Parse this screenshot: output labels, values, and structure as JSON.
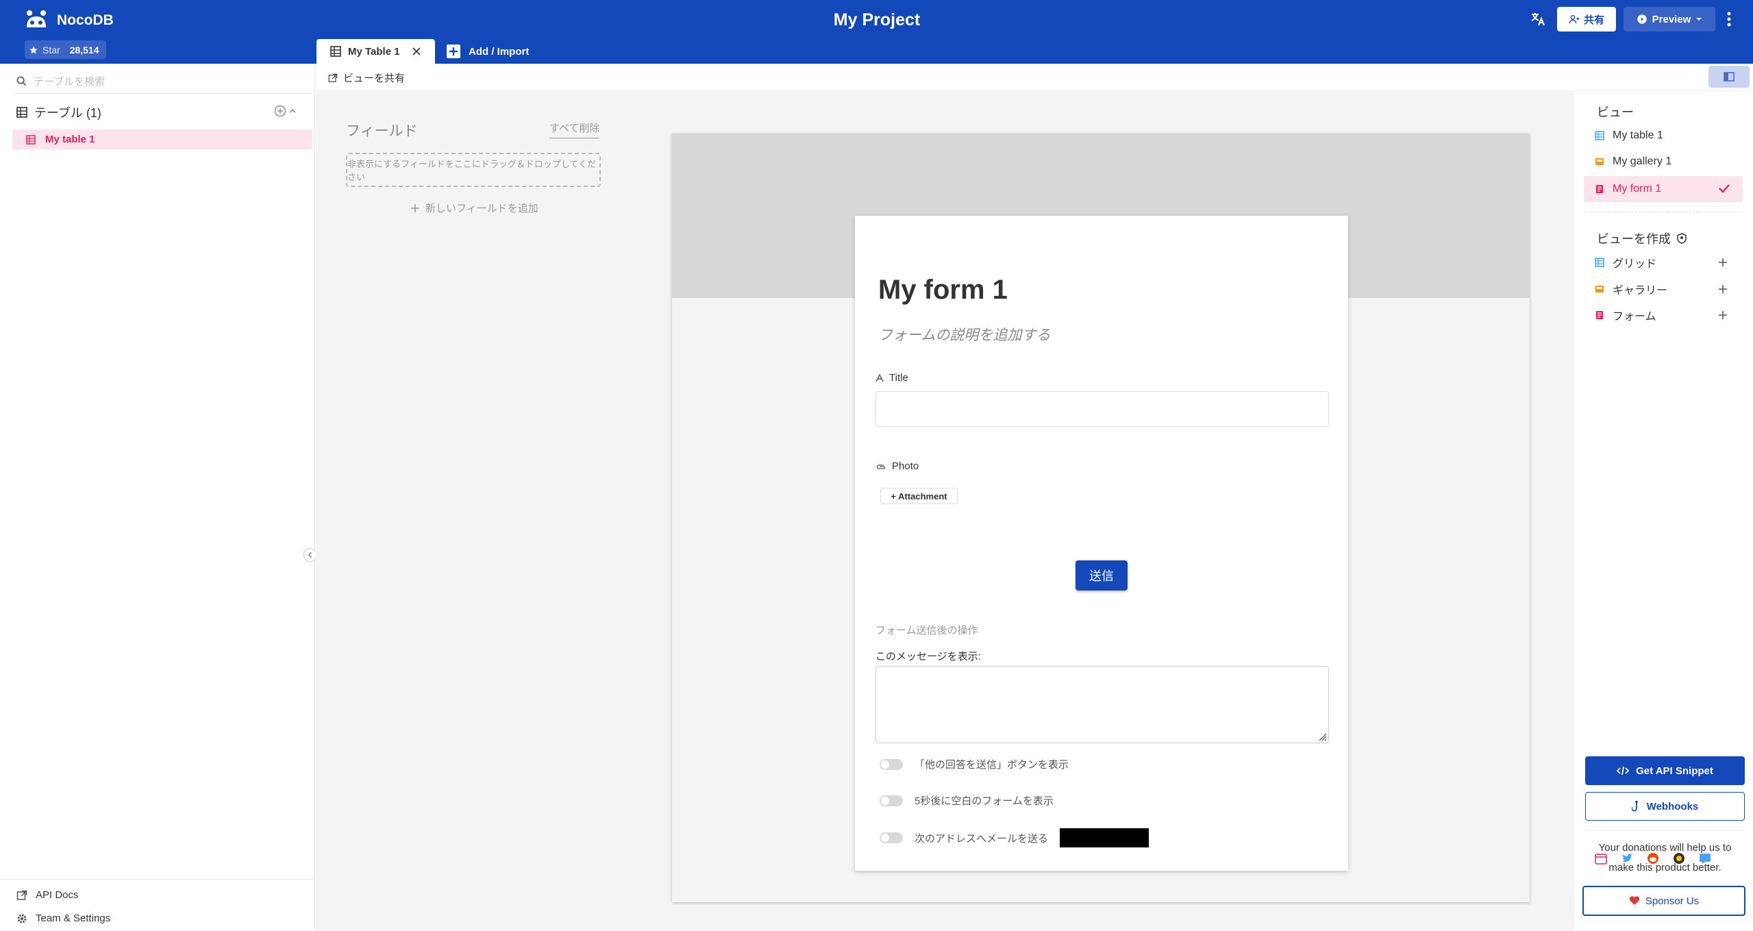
{
  "header": {
    "brand": "NocoDB",
    "star_label": "Star",
    "star_count": "28,514",
    "project_title": "My Project",
    "share_label": "共有",
    "preview_label": "Preview"
  },
  "tabs": [
    {
      "label": "My Table 1"
    },
    {
      "label": "Add / Import"
    }
  ],
  "sidebar": {
    "search_placeholder": "テーブルを検索",
    "tables_heading": "テーブル (1)",
    "tables": [
      {
        "label": "My table 1"
      }
    ],
    "footer": {
      "api_docs": "API Docs",
      "team_settings": "Team & Settings"
    }
  },
  "toolbar": {
    "share_view": "ビューを共有"
  },
  "fields_panel": {
    "heading": "フィールド",
    "clear_all": "すべて削除",
    "drop_hint": "非表示にするフィールドをここにドラッグ＆ドロップしてください",
    "add_field": "新しいフィールドを追加"
  },
  "form": {
    "title": "My form 1",
    "description_placeholder": "フォームの説明を追加する",
    "fields": [
      {
        "label": "Title",
        "type": "text"
      },
      {
        "label": "Photo",
        "type": "attachment"
      }
    ],
    "attachment_button": "+ Attachment",
    "submit_label": "送信",
    "after_submit_heading": "フォーム送信後の操作",
    "message_label": "このメッセージを表示:",
    "toggles": [
      {
        "label": "「他の回答を送信」ボタンを表示",
        "on": false
      },
      {
        "label": "5秒後に空白のフォームを表示",
        "on": false
      },
      {
        "label": "次のアドレスへメールを送る",
        "on": false
      }
    ]
  },
  "views_panel": {
    "heading": "ビュー",
    "views": [
      {
        "label": "My table 1",
        "type": "grid",
        "active": false
      },
      {
        "label": "My gallery 1",
        "type": "gallery",
        "active": false
      },
      {
        "label": "My form 1",
        "type": "form",
        "active": true
      }
    ],
    "create_heading": "ビューを作成",
    "create_options": [
      {
        "label": "グリッド",
        "type": "grid"
      },
      {
        "label": "ギャラリー",
        "type": "gallery"
      },
      {
        "label": "フォーム",
        "type": "form"
      }
    ],
    "api_snippet": "Get API Snippet",
    "webhooks": "Webhooks",
    "donation_text": "Your donations will help us to make this product better.",
    "sponsor_label": "Sponsor Us"
  },
  "colors": {
    "primary": "#1348ba",
    "accent_pink": "#e91e63",
    "grid_icon": "#42a5f5",
    "gallery_icon": "#ff9800",
    "form_icon": "#e91e63"
  }
}
